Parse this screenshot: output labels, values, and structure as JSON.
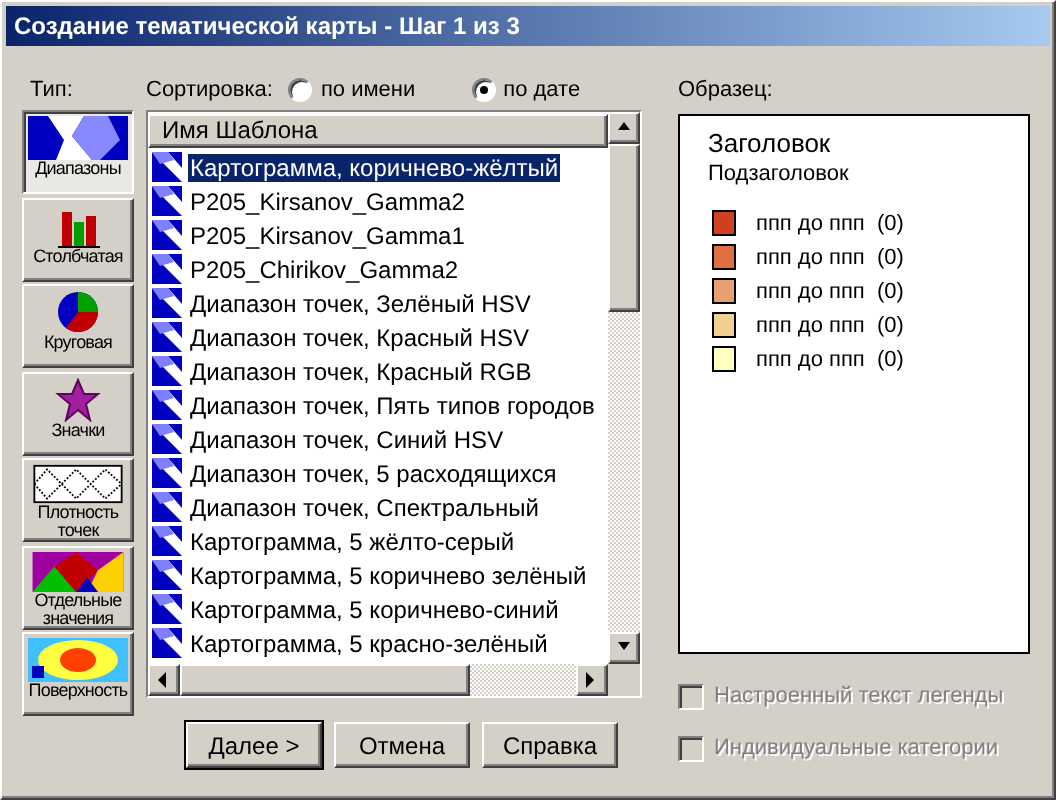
{
  "window": {
    "title": "Создание тематической карты - Шаг 1 из 3"
  },
  "type_label": "Тип:",
  "types": [
    {
      "kind": "ranges",
      "label": "Диапазоны",
      "selected": true
    },
    {
      "kind": "bars",
      "label": "Столбчатая",
      "selected": false
    },
    {
      "kind": "pie",
      "label": "Круговая",
      "selected": false
    },
    {
      "kind": "symbols",
      "label": "Значки",
      "selected": false
    },
    {
      "kind": "density",
      "label": "Плотность точек",
      "selected": false
    },
    {
      "kind": "individual",
      "label": "Отдельные значения",
      "selected": false
    },
    {
      "kind": "surface",
      "label": "Поверхность",
      "selected": false
    }
  ],
  "sort": {
    "label": "Сортировка:",
    "options": [
      {
        "label": "по имени",
        "selected": false
      },
      {
        "label": "по дате",
        "selected": true
      }
    ]
  },
  "templates": {
    "header": "Имя Шаблона",
    "rows": [
      {
        "label": "Картограмма, коричнево-жёлтый",
        "selected": true
      },
      {
        "label": "P205_Kirsanov_Gamma2",
        "selected": false
      },
      {
        "label": "P205_Kirsanov_Gamma1",
        "selected": false
      },
      {
        "label": "P205_Chirikov_Gamma2",
        "selected": false
      },
      {
        "label": "Диапазон точек, Зелёный HSV",
        "selected": false
      },
      {
        "label": "Диапазон точек, Красный HSV",
        "selected": false
      },
      {
        "label": "Диапазон точек, Красный RGB",
        "selected": false
      },
      {
        "label": "Диапазон точек, Пять типов городов",
        "selected": false
      },
      {
        "label": "Диапазон точек, Синий HSV",
        "selected": false
      },
      {
        "label": "Диапазон точек, 5 расходящихся",
        "selected": false
      },
      {
        "label": "Диапазон точек, Спектральный",
        "selected": false
      },
      {
        "label": "Картограмма, 5 жёлто-серый",
        "selected": false
      },
      {
        "label": "Картограмма, 5 коричнево зелёный",
        "selected": false
      },
      {
        "label": "Картограмма, 5 коричнево-синий",
        "selected": false
      },
      {
        "label": "Картограмма, 5 красно-зелёный",
        "selected": false
      }
    ]
  },
  "sample": {
    "label": "Образец:",
    "title": "Заголовок",
    "subtitle": "Подзаголовок",
    "items": [
      {
        "label": "ппп до ппп",
        "count": "(0)",
        "color": "#d04020"
      },
      {
        "label": "ппп до ппп",
        "count": "(0)",
        "color": "#e07040"
      },
      {
        "label": "ппп до ппп",
        "count": "(0)",
        "color": "#e8a070"
      },
      {
        "label": "ппп до ппп",
        "count": "(0)",
        "color": "#f0d090"
      },
      {
        "label": "ппп до ппп",
        "count": "(0)",
        "color": "#ffffc0"
      }
    ]
  },
  "options": [
    {
      "label": "Настроенный текст легенды",
      "checked": false,
      "disabled": true
    },
    {
      "label": "Индивидуальные категории",
      "checked": false,
      "disabled": true
    }
  ],
  "buttons": [
    {
      "label": "Далее >",
      "default": true
    },
    {
      "label": "Отмена",
      "default": false
    },
    {
      "label": "Справка",
      "default": false
    }
  ]
}
